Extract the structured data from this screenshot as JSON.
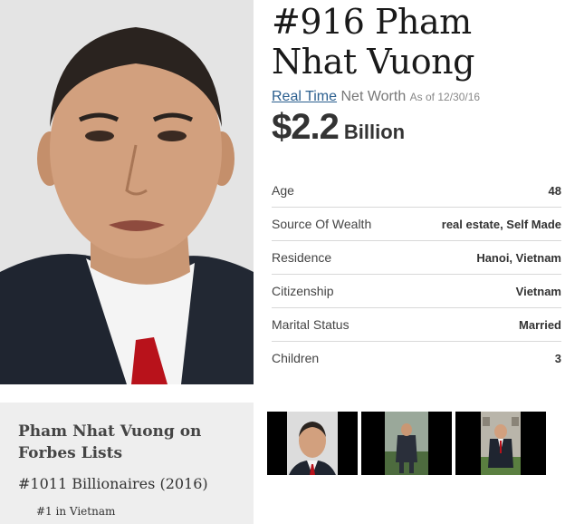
{
  "profile": {
    "rank_name": "#916 Pham Nhat Vuong",
    "net_worth": {
      "link_label": "Real Time",
      "label": "Net Worth",
      "as_of": "As of 12/30/16",
      "amount": "$2.2",
      "unit": "Billion"
    },
    "stats": [
      {
        "label": "Age",
        "value": "48"
      },
      {
        "label": "Source Of Wealth",
        "value": "real estate, Self Made"
      },
      {
        "label": "Residence",
        "value": "Hanoi, Vietnam"
      },
      {
        "label": "Citizenship",
        "value": "Vietnam"
      },
      {
        "label": "Marital Status",
        "value": "Married"
      },
      {
        "label": "Children",
        "value": "3"
      }
    ]
  },
  "forbes_lists": {
    "title": "Pham Nhat Vuong on Forbes Lists",
    "rank": "#1011 Billionaires (2016)",
    "sub": "#1 in Vietnam"
  },
  "colors": {
    "link": "#2b5f8f",
    "panel_bg": "#eeeeee",
    "divider": "#d8d8d8"
  }
}
